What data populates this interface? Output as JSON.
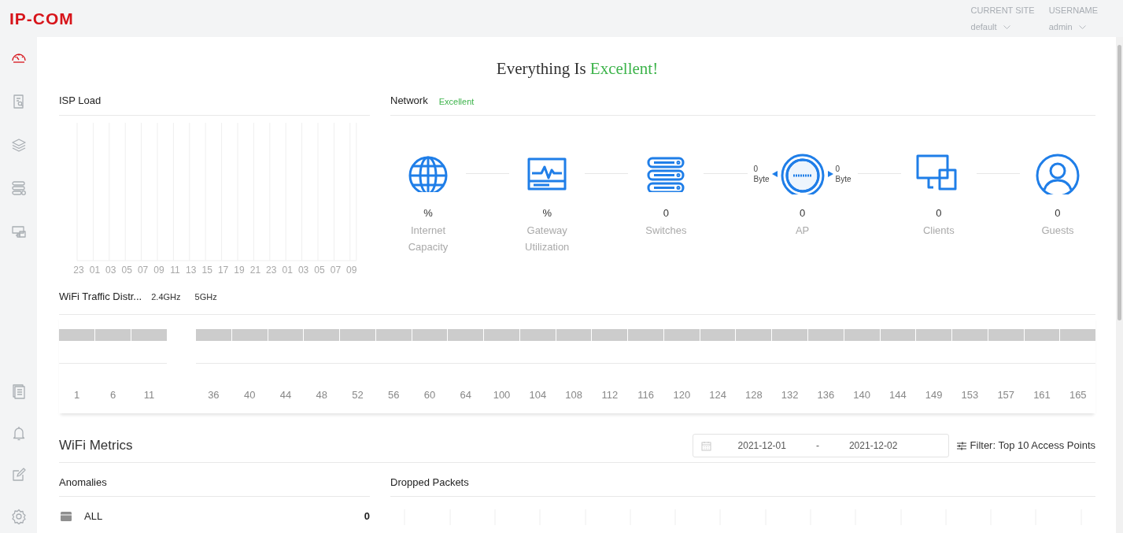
{
  "header": {
    "logo": "IP-COM",
    "site": {
      "label": "CURRENT SITE",
      "value": "default"
    },
    "user": {
      "label": "USERNAME",
      "value": "admin"
    }
  },
  "sidebar": {
    "items": [
      {
        "kind": "gauge",
        "selected": true
      },
      {
        "kind": "report",
        "selected": false
      },
      {
        "kind": "layers",
        "selected": false
      },
      {
        "kind": "devices",
        "selected": false
      },
      {
        "kind": "screens",
        "selected": false
      }
    ],
    "bottom_items": [
      {
        "kind": "document",
        "selected": false
      },
      {
        "kind": "bell",
        "selected": false
      },
      {
        "kind": "edit",
        "selected": false
      },
      {
        "kind": "gear",
        "selected": false
      }
    ]
  },
  "headline": {
    "text": "Everything Is",
    "status": "Excellent!"
  },
  "isp_load": {
    "title": "ISP Load",
    "x_labels": [
      "23",
      "01",
      "03",
      "05",
      "07",
      "09",
      "11",
      "13",
      "15",
      "17",
      "19",
      "21",
      "23",
      "01",
      "03",
      "05",
      "07",
      "09"
    ]
  },
  "network": {
    "title": "Network",
    "status": "Excellent",
    "nodes": [
      {
        "kind": "globe",
        "value": "%",
        "label": "Internet Capacity"
      },
      {
        "kind": "gateway",
        "value": "%",
        "label": "Gateway Utilization"
      },
      {
        "kind": "switches",
        "value": "0",
        "label": "Switches"
      },
      {
        "kind": "ap",
        "value": "0",
        "label": "AP",
        "left_value": "0",
        "left_unit": "Byte",
        "right_value": "0",
        "right_unit": "Byte"
      },
      {
        "kind": "clients",
        "value": "0",
        "label": "Clients"
      },
      {
        "kind": "guests",
        "value": "0",
        "label": "Guests"
      }
    ]
  },
  "wifi_traffic": {
    "title": "WiFi Traffic Distr...",
    "bands": [
      {
        "label": "2.4GHz",
        "channels": [
          "1",
          "6",
          "11"
        ]
      },
      {
        "label": "5GHz",
        "channels": [
          "36",
          "40",
          "44",
          "48",
          "52",
          "56",
          "60",
          "64",
          "100",
          "104",
          "108",
          "112",
          "116",
          "120",
          "124",
          "128",
          "132",
          "136",
          "140",
          "144",
          "149",
          "153",
          "157",
          "161",
          "165"
        ]
      }
    ]
  },
  "wifi_metrics": {
    "title": "WiFi Metrics",
    "date_from": "2021-12-01",
    "date_separator": "-",
    "date_to": "2021-12-02",
    "filter": "Filter: Top 10 Access Points",
    "anomalies": {
      "title": "Anomalies",
      "rows": [
        {
          "label": "ALL",
          "value": "0"
        }
      ]
    },
    "dropped_packets": {
      "title": "Dropped Packets"
    }
  }
}
